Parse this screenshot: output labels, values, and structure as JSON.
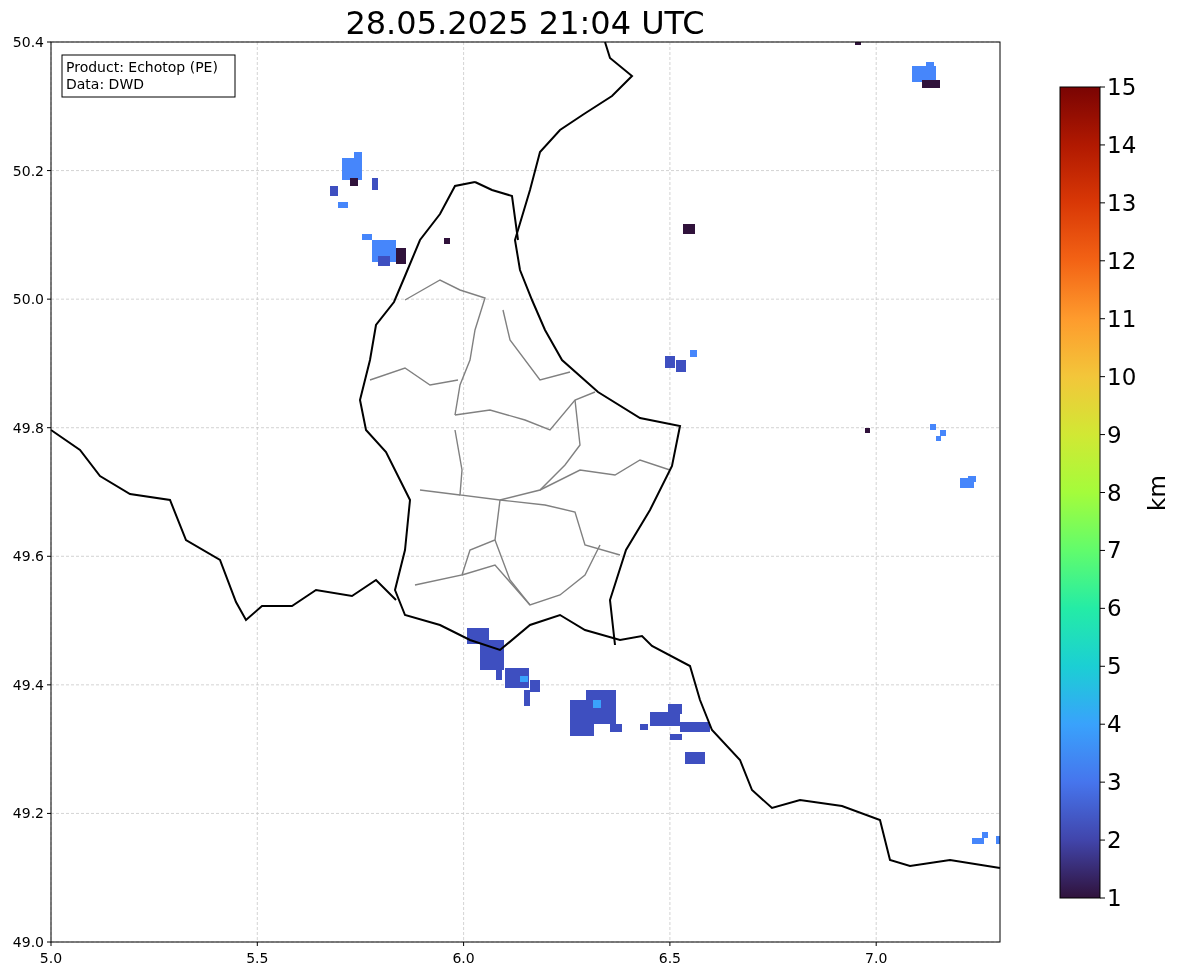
{
  "title": "28.05.2025 21:04 UTC",
  "info_box": [
    "Product: Echotop (PE)",
    "Data: DWD"
  ],
  "x_axis": {
    "ticks": [
      "5.0",
      "5.5",
      "6.0",
      "6.5",
      "7.0"
    ]
  },
  "y_axis": {
    "ticks": [
      "50.4",
      "50.2",
      "50.0",
      "49.8",
      "49.6",
      "49.4",
      "49.2",
      "49.0"
    ]
  },
  "colorbar": {
    "label": "km",
    "ticks": [
      "15",
      "14",
      "13",
      "12",
      "11",
      "10",
      "9",
      "8",
      "7",
      "6",
      "5",
      "4",
      "3",
      "2",
      "1"
    ]
  }
}
